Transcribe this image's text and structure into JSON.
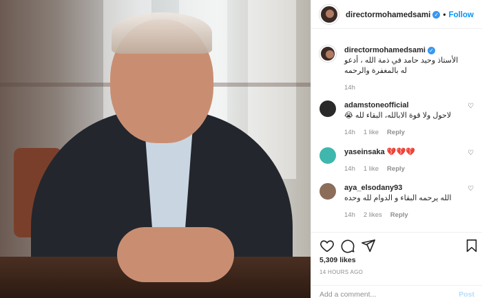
{
  "post": {
    "username": "directormohamedsami",
    "follow_label": "Follow",
    "separator": "•"
  },
  "caption": {
    "username": "directormohamedsami",
    "text": "الأستاذ وحيد حامد في ذمة الله ، أدعو له بالمغفرة والرحمه",
    "time": "14h"
  },
  "comments": [
    {
      "username": "adamstoneofficial",
      "text": "لاحول ولا قوة الابالله، البقاء لله 😭",
      "time": "14h",
      "likes": "1 like",
      "reply": "Reply"
    },
    {
      "username": "yaseinsaka",
      "text": "💔💔💔",
      "time": "14h",
      "likes": "1 like",
      "reply": "Reply"
    },
    {
      "username": "aya_elsodany93",
      "text": "الله يرحمه البقاء و الدوام لله وحده",
      "time": "14h",
      "likes": "2 likes",
      "reply": "Reply"
    }
  ],
  "stats": {
    "likes": "5,309 likes",
    "time": "14 HOURS AGO"
  },
  "add_comment": {
    "placeholder": "Add a comment...",
    "post_label": "Post"
  },
  "icons": {
    "like": "heart-icon",
    "comment": "comment-icon",
    "share": "share-icon",
    "save": "bookmark-icon",
    "verified": "verified-badge-icon"
  },
  "colors": {
    "accent": "#0095f6",
    "verified": "#3897f0",
    "muted": "#8e8e8e"
  }
}
